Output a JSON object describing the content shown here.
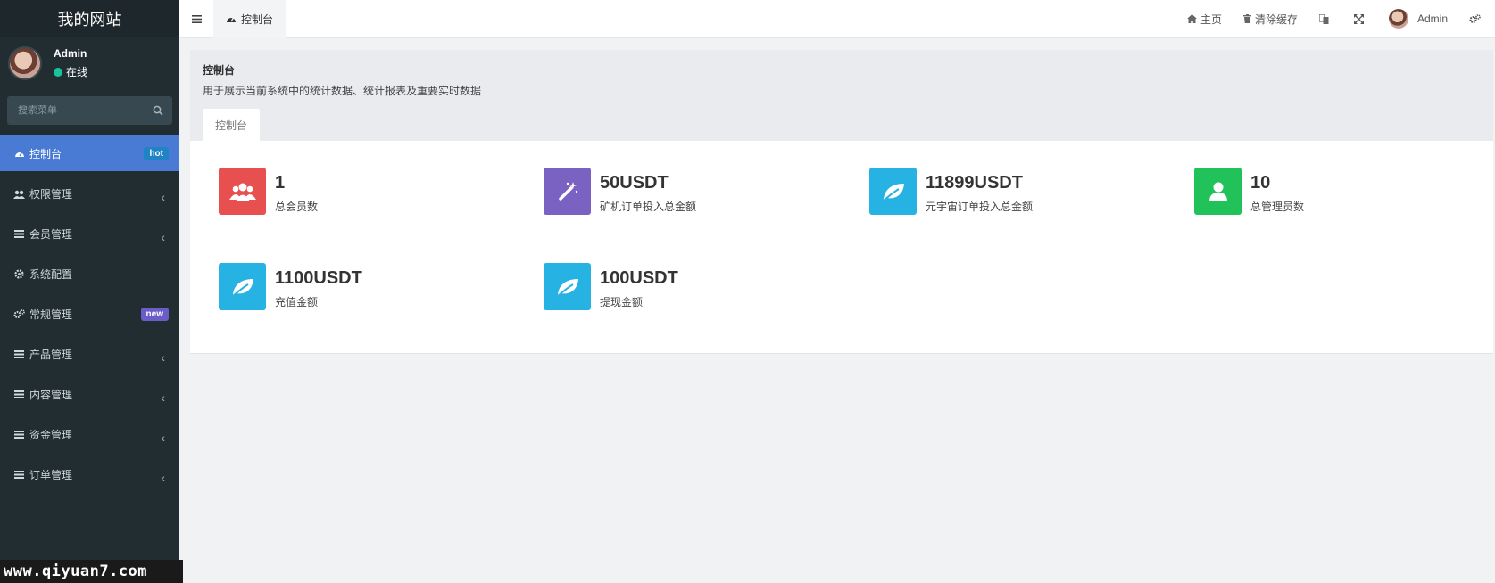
{
  "sidebar": {
    "brand": "我的网站",
    "user": {
      "name": "Admin",
      "status": "在线"
    },
    "search_placeholder": "搜索菜单",
    "items": [
      {
        "label": "控制台",
        "badge": "hot",
        "active": true
      },
      {
        "label": "权限管理",
        "chevron": "‹"
      },
      {
        "label": "会员管理",
        "chevron": "‹"
      },
      {
        "label": "系统配置"
      },
      {
        "label": "常规管理",
        "badge": "new"
      },
      {
        "label": "产品管理",
        "chevron": "‹"
      },
      {
        "label": "内容管理",
        "chevron": "‹"
      },
      {
        "label": "资金管理",
        "chevron": "‹"
      },
      {
        "label": "订单管理",
        "chevron": "‹"
      }
    ]
  },
  "watermark": "www.qiyuan7.com",
  "topbar": {
    "tab": "控制台",
    "home": "主页",
    "clear_cache": "清除缓存",
    "admin": "Admin"
  },
  "panel": {
    "title": "控制台",
    "description": "用于展示当前系统中的统计数据、统计报表及重要实时数据",
    "tab": "控制台"
  },
  "stats": [
    {
      "value": "1",
      "label": "总会员数",
      "color": "#e84f4f",
      "icon": "users-icon"
    },
    {
      "value": "50USDT",
      "label": "矿机订单投入总金额",
      "color": "#7a62c2",
      "icon": "magic-wand-icon"
    },
    {
      "value": "11899USDT",
      "label": "元宇宙订单投入总金额",
      "color": "#27b2e4",
      "icon": "leaf-icon"
    },
    {
      "value": "10",
      "label": "总管理员数",
      "color": "#22c25a",
      "icon": "user-icon"
    },
    {
      "value": "1100USDT",
      "label": "充值金额",
      "color": "#27b2e4",
      "icon": "leaf-icon"
    },
    {
      "value": "100USDT",
      "label": "提现金额",
      "color": "#27b2e4",
      "icon": "leaf-icon"
    }
  ]
}
